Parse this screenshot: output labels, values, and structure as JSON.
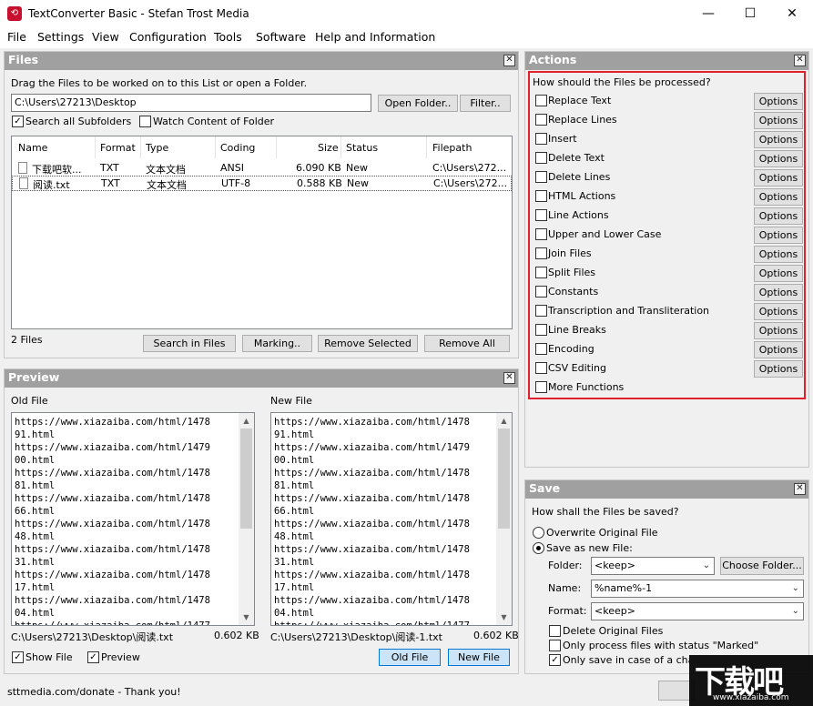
{
  "window": {
    "title": "TextConverter Basic - Stefan Trost Media",
    "minimize": "—",
    "maximize": "☐",
    "close": "✕"
  },
  "menu": [
    "File",
    "Settings",
    "View",
    "Configuration",
    "Tools",
    "Software",
    "Help and Information"
  ],
  "files": {
    "header": "Files",
    "hint": "Drag the Files to be worked on to this List or open a Folder.",
    "path": "C:\\Users\\27213\\Desktop",
    "open_folder": "Open Folder..",
    "filter": "Filter..",
    "search_subfolders": "Search all Subfolders",
    "watch_folder": "Watch Content of Folder",
    "columns": [
      "Name",
      "Format",
      "Type",
      "Coding",
      "Size",
      "Status",
      "Filepath"
    ],
    "rows": [
      {
        "name": "下载吧软...",
        "format": "TXT",
        "type": "文本文档",
        "coding": "ANSI",
        "size": "6.090 KB",
        "status": "New",
        "path": "C:\\Users\\272..."
      },
      {
        "name": "阅读.txt",
        "format": "TXT",
        "type": "文本文档",
        "coding": "UTF-8",
        "size": "0.588 KB",
        "status": "New",
        "path": "C:\\Users\\272..."
      }
    ],
    "count": "2 Files",
    "search_in_files": "Search in Files",
    "marking": "Marking..",
    "remove_selected": "Remove Selected",
    "remove_all": "Remove All"
  },
  "preview": {
    "header": "Preview",
    "old_label": "Old File",
    "new_label": "New File",
    "old_lines": [
      "https://www.xiazaiba.com/html/1478",
      "91.html",
      "https://www.xiazaiba.com/html/1479",
      "00.html",
      "https://www.xiazaiba.com/html/1478",
      "81.html",
      "https://www.xiazaiba.com/html/1478",
      "66.html",
      "https://www.xiazaiba.com/html/1478",
      "48.html",
      "https://www.xiazaiba.com/html/1478",
      "31.html",
      "https://www.xiazaiba.com/html/1478",
      "17.html",
      "https://www.xiazaiba.com/html/1478",
      "04.html",
      "https://www.xiazaiba.com/html/1477"
    ],
    "new_lines": [
      "https://www.xiazaiba.com/html/1478",
      "91.html",
      "https://www.xiazaiba.com/html/1479",
      "00.html",
      "https://www.xiazaiba.com/html/1478",
      "81.html",
      "https://www.xiazaiba.com/html/1478",
      "66.html",
      "https://www.xiazaiba.com/html/1478",
      "48.html",
      "https://www.xiazaiba.com/html/1478",
      "31.html",
      "https://www.xiazaiba.com/html/1478",
      "17.html",
      "https://www.xiazaiba.com/html/1478",
      "04.html",
      "https://www.xiazaiba.com/html/1477"
    ],
    "old_path": "C:\\Users\\27213\\Desktop\\阅读.txt",
    "old_size": "0.602 KB",
    "new_path": "C:\\Users\\27213\\Desktop\\阅读-1.txt",
    "new_size": "0.602 KB",
    "show_file": "Show File",
    "preview_chk": "Preview",
    "old_file_btn": "Old File",
    "new_file_btn": "New File"
  },
  "actions": {
    "header": "Actions",
    "question": "How should the Files be processed?",
    "options_label": "Options",
    "items": [
      "Replace Text",
      "Replace Lines",
      "Insert",
      "Delete Text",
      "Delete Lines",
      "HTML Actions",
      "Line Actions",
      "Upper and Lower Case",
      "Join Files",
      "Split Files",
      "Constants",
      "Transcription and Transliteration",
      "Line Breaks",
      "Encoding",
      "CSV Editing",
      "More Functions"
    ],
    "highlight_color": "#e0202a"
  },
  "save": {
    "header": "Save",
    "question": "How shall the Files be saved?",
    "overwrite": "Overwrite Original File",
    "save_new": "Save as new File:",
    "folder_label": "Folder:",
    "folder_value": "<keep>",
    "choose_folder": "Choose Folder...",
    "name_label": "Name:",
    "name_value": "%name%-1",
    "format_label": "Format:",
    "format_value": "<keep>",
    "delete_original": "Delete Original Files",
    "only_marked": "Only process files with status \"Marked\"",
    "only_change": "Only save in case of a change"
  },
  "status": {
    "text": "sttmedia.com/donate - Thank you!"
  },
  "watermark": {
    "text": "下载吧",
    "url": "www.xiazaiba.com"
  }
}
